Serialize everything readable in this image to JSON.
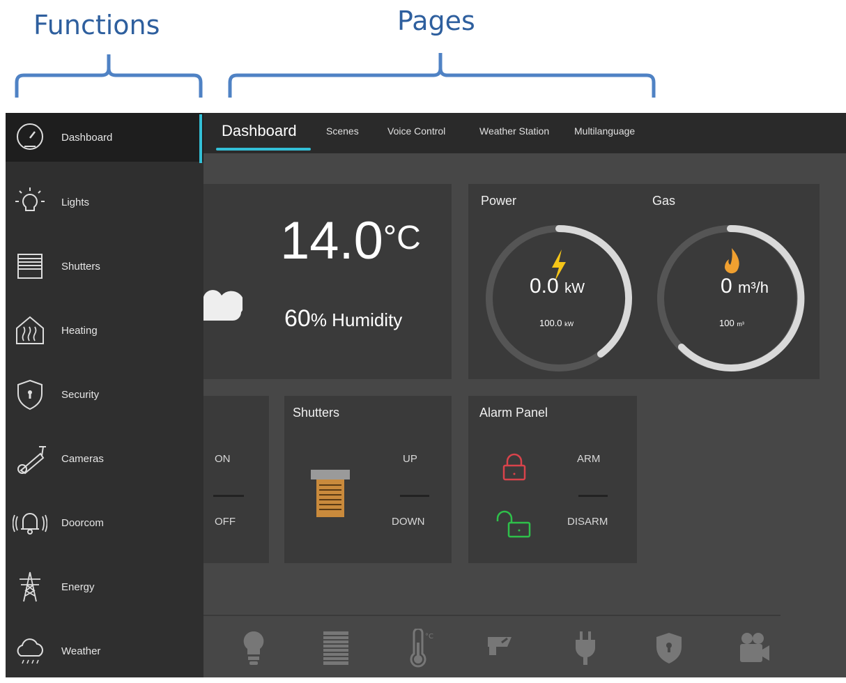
{
  "annotations": {
    "functions": "Functions",
    "pages": "Pages"
  },
  "sidebar": {
    "items": [
      {
        "label": "Dashboard",
        "icon": "gauge-icon",
        "active": true
      },
      {
        "label": "Lights",
        "icon": "lightbulb-icon"
      },
      {
        "label": "Shutters",
        "icon": "shutter-icon"
      },
      {
        "label": "Heating",
        "icon": "heating-icon"
      },
      {
        "label": "Security",
        "icon": "shield-lock-icon"
      },
      {
        "label": "Cameras",
        "icon": "camera-icon"
      },
      {
        "label": "Doorcom",
        "icon": "bell-icon"
      },
      {
        "label": "Energy",
        "icon": "power-pylon-icon"
      },
      {
        "label": "Weather",
        "icon": "rain-cloud-icon"
      }
    ]
  },
  "tabs": [
    {
      "label": "Dashboard",
      "active": true
    },
    {
      "label": "Scenes"
    },
    {
      "label": "Voice Control"
    },
    {
      "label": "Weather Station"
    },
    {
      "label": "Multilanguage"
    }
  ],
  "weather_card": {
    "temperature": "14.0",
    "temp_unit": "°C",
    "humidity": "60",
    "humidity_label": "% Humidity"
  },
  "energy_card": {
    "power": {
      "title": "Power",
      "value": "0.0",
      "unit": "kW",
      "max": "100.0",
      "max_unit": "kW"
    },
    "gas": {
      "title": "Gas",
      "value": "0",
      "unit": "m³/h",
      "max": "100",
      "max_unit": "m³"
    }
  },
  "lights_card": {
    "on": "ON",
    "off": "OFF"
  },
  "shutters_card": {
    "title": "Shutters",
    "up": "UP",
    "down": "DOWN"
  },
  "alarm_card": {
    "title": "Alarm Panel",
    "arm": "ARM",
    "disarm": "DISARM"
  },
  "bottom_bar": [
    "lightbulb-icon",
    "shutter-icon",
    "thermometer-icon",
    "camera-icon",
    "plug-icon",
    "shield-icon",
    "video-camera-icon"
  ],
  "colors": {
    "accent": "#33bfd6",
    "power": "#f5c518",
    "gas": "#f0a030",
    "alarm_locked": "#d9434b",
    "alarm_unlocked": "#2ec04a",
    "shutter": "#c98a3c"
  }
}
